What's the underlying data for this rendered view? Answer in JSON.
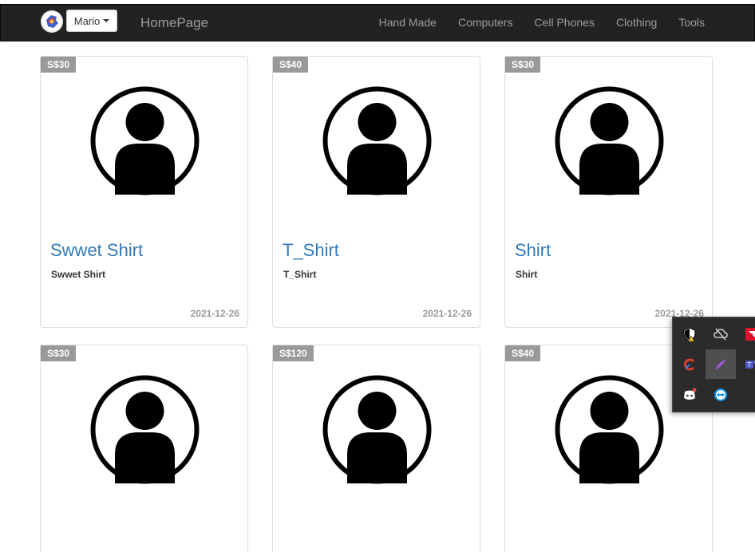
{
  "navbar": {
    "user_button": "Mario",
    "brand": "HomePage",
    "links": [
      "Hand Made",
      "Computers",
      "Cell Phones",
      "Clothing",
      "Tools"
    ]
  },
  "products": [
    {
      "price": "S$30",
      "title": "Swwet Shirt",
      "description": "Swwet Shirt",
      "date": "2021-12-26"
    },
    {
      "price": "S$40",
      "title": "T_Shirt",
      "description": "T_Shirt",
      "date": "2021-12-26"
    },
    {
      "price": "S$30",
      "title": "Shirt",
      "description": "Shirt",
      "date": "2021-12-26"
    },
    {
      "price": "S$30",
      "title": "",
      "description": "",
      "date": ""
    },
    {
      "price": "S$120",
      "title": "",
      "description": "",
      "date": ""
    },
    {
      "price": "S$40",
      "title": "",
      "description": "",
      "date": ""
    }
  ],
  "tray": {
    "icons": [
      "security-warning-icon",
      "cloud-off-icon",
      "amd-icon",
      "ccleaner-icon",
      "feather-pen-icon",
      "teams-icon",
      "discord-icon",
      "teamviewer-icon"
    ]
  }
}
